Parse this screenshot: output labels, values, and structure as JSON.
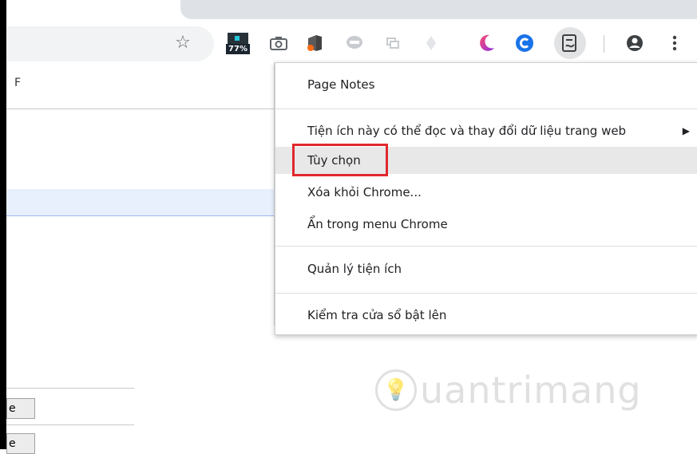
{
  "toolbar": {
    "badge_label": "77%"
  },
  "page": {
    "partial_tab_text": "F",
    "button_partial_text_1": "e",
    "button_partial_text_2": "e"
  },
  "context_menu": {
    "title": "Page Notes",
    "items": [
      {
        "label": "Tiện ích này có thể đọc và thay đổi dữ liệu trang web",
        "has_submenu": true
      },
      {
        "label": "Tùy chọn",
        "highlighted": true
      },
      {
        "label": "Xóa khỏi Chrome..."
      },
      {
        "label": "Ẩn trong menu Chrome"
      },
      {
        "label": "Quản lý tiện ích"
      },
      {
        "label": "Kiểm tra cửa sổ bật lên"
      }
    ]
  },
  "watermark": {
    "text": "uantrimang"
  },
  "colors": {
    "highlight_box": "#e0282e",
    "menu_hover": "#e8e8e8"
  }
}
